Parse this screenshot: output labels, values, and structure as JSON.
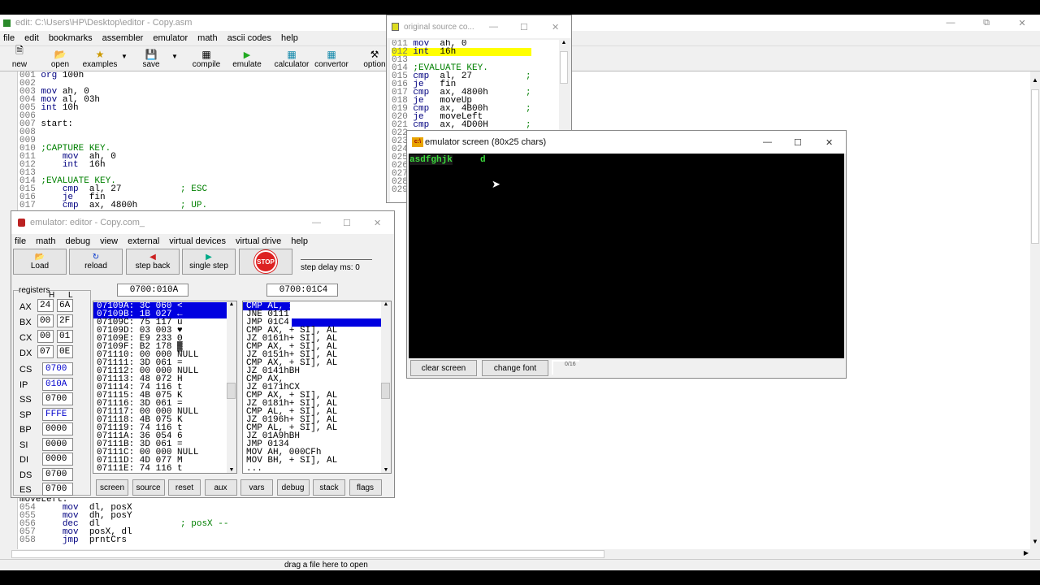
{
  "editor": {
    "title": "edit: C:\\Users\\HP\\Desktop\\editor - Copy.asm",
    "menu": [
      "file",
      "edit",
      "bookmarks",
      "assembler",
      "emulator",
      "math",
      "ascii codes",
      "help"
    ],
    "toolbar": {
      "new": "new",
      "open": "open",
      "examples": "examples",
      "save": "save",
      "compile": "compile",
      "emulate": "emulate",
      "calculator": "calculator",
      "convertor": "convertor",
      "options": "option"
    },
    "code_top": [
      {
        "ln": "001",
        "code": "org 100h"
      },
      {
        "ln": "002",
        "code": ""
      },
      {
        "ln": "003",
        "code": "mov ah, 0"
      },
      {
        "ln": "004",
        "code": "mov al, 03h"
      },
      {
        "ln": "005",
        "code": "int 10h"
      },
      {
        "ln": "006",
        "code": ""
      },
      {
        "ln": "007",
        "code": "start:"
      },
      {
        "ln": "008",
        "code": ""
      },
      {
        "ln": "009",
        "code": ""
      },
      {
        "ln": "010",
        "code": ";CAPTURE KEY."
      },
      {
        "ln": "011",
        "code": "    mov  ah, 0"
      },
      {
        "ln": "012",
        "code": "    int  16h"
      },
      {
        "ln": "013",
        "code": ""
      },
      {
        "ln": "014",
        "code": ";EVALUATE KEY."
      },
      {
        "ln": "015",
        "code": "    cmp  al, 27           ; ESC"
      },
      {
        "ln": "016",
        "code": "    je   fin"
      },
      {
        "ln": "017",
        "code": "    cmp  ax, 4800h        ; UP."
      }
    ],
    "code_bottom": [
      {
        "ln": "",
        "code": "moveLeft:"
      },
      {
        "ln": "054",
        "code": "    mov  dl, posX"
      },
      {
        "ln": "055",
        "code": "    mov  dh, posY"
      },
      {
        "ln": "056",
        "code": "    dec  dl               ; posX --"
      },
      {
        "ln": "057",
        "code": "    mov  posX, dl"
      },
      {
        "ln": "058",
        "code": "    jmp  prntCrs"
      }
    ],
    "status": "drag a file here to open"
  },
  "original_source": {
    "title": "original source co...",
    "lines": [
      {
        "ln": "011",
        "code": "mov  ah, 0"
      },
      {
        "ln": "012",
        "code": "int  16h"
      },
      {
        "ln": "013",
        "code": ""
      },
      {
        "ln": "014",
        "code": ";EVALUATE KEY."
      },
      {
        "ln": "015",
        "code": "cmp  al, 27          ;"
      },
      {
        "ln": "016",
        "code": "je   fin"
      },
      {
        "ln": "017",
        "code": "cmp  ax, 4800h       ;"
      },
      {
        "ln": "018",
        "code": "je   moveUp"
      },
      {
        "ln": "019",
        "code": "cmp  ax, 4B00h       ;"
      },
      {
        "ln": "020",
        "code": "je   moveLeft"
      },
      {
        "ln": "021",
        "code": "cmp  ax, 4D00H       ;"
      }
    ],
    "extra_ln": [
      "022",
      "023",
      "024",
      "025",
      "026",
      "027",
      "028",
      "029"
    ]
  },
  "emulator": {
    "title": "emulator: editor - Copy.com_",
    "menu": [
      "file",
      "math",
      "debug",
      "view",
      "external",
      "virtual devices",
      "virtual drive",
      "help"
    ],
    "buttons": {
      "load": "Load",
      "reload": "reload",
      "step_back": "step back",
      "single_step": "single step",
      "stop": "STOP",
      "step_delay": "step delay ms: 0"
    },
    "registers_label": "registers",
    "h": "H",
    "l": "L",
    "addr_left": "0700:010A",
    "addr_right": "0700:01C4",
    "regs8": [
      {
        "name": "AX",
        "h": "24",
        "l": "6A"
      },
      {
        "name": "BX",
        "h": "00",
        "l": "2F"
      },
      {
        "name": "CX",
        "h": "00",
        "l": "01"
      },
      {
        "name": "DX",
        "h": "07",
        "l": "0E"
      }
    ],
    "regs16": [
      {
        "name": "CS",
        "v": "0700"
      },
      {
        "name": "IP",
        "v": "010A"
      },
      {
        "name": "SS",
        "v": "0700"
      },
      {
        "name": "SP",
        "v": "FFFE"
      },
      {
        "name": "BP",
        "v": "0000"
      },
      {
        "name": "SI",
        "v": "0000"
      },
      {
        "name": "DI",
        "v": "0000"
      },
      {
        "name": "DS",
        "v": "0700"
      },
      {
        "name": "ES",
        "v": "0700"
      }
    ],
    "memory": [
      "07109A: 3C 060 <",
      "07109B: 1B 027 ←",
      "07109C: 75 117 u",
      "07109D: 03 003 ♥",
      "07109E: E9 233 Θ",
      "07109F: B2 178 ▓",
      "071110: 00 000 NULL",
      "071111: 3D 061 =",
      "071112: 00 000 NULL",
      "071113: 48 072 H",
      "071114: 74 116 t",
      "071115: 4B 075 K",
      "071116: 3D 061 =",
      "071117: 00 000 NULL",
      "071118: 4B 075 K",
      "071119: 74 116 t",
      "07111A: 36 054 6",
      "07111B: 3D 061 =",
      "07111C: 00 000 NULL",
      "07111D: 4D 077 M",
      "07111E: 74 116 t"
    ],
    "disasm": [
      "CMP AL, 1Bh",
      "JNE 0111",
      "JMP 01C4",
      "CMP AX, + SI], AL",
      "JZ 0161h+ SI], AL",
      "CMP AX, + SI], AL",
      "JZ 0151h+ SI], AL",
      "CMP AX, + SI], AL",
      "JZ 0141hBH",
      "CMP AX,",
      "JZ 0171hCX",
      "CMP AX, + SI], AL",
      "JZ 0181h+ SI], AL",
      "CMP AL, + SI], AL",
      "JZ 0196h+ SI], AL",
      "CMP AL, + SI], AL",
      "JZ 01A9hBH",
      "JMP 0134",
      "MOV AH, 000CFh",
      "MOV BH, + SI], AL",
      "..."
    ],
    "bottom_buttons": [
      "screen",
      "source",
      "reset",
      "aux",
      "vars",
      "debug",
      "stack",
      "flags"
    ]
  },
  "screen": {
    "title": "emulator screen (80x25 chars)",
    "text1": "asdfghjk",
    "text2": "d",
    "buttons": {
      "clear": "clear screen",
      "font": "change font"
    },
    "coord": "0/16"
  }
}
